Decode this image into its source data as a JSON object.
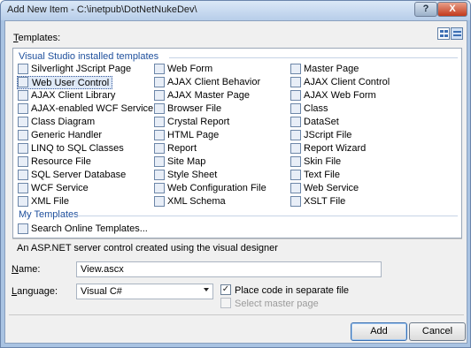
{
  "window": {
    "title": "Add New Item - C:\\inetpub\\DotNetNukeDev\\",
    "help_label": "?",
    "close_label": "X"
  },
  "templates_label": "Templates:",
  "view_buttons": [
    "large-icons-view",
    "small-icons-view"
  ],
  "groups": {
    "installed": "Visual Studio installed templates",
    "my": "My Templates"
  },
  "items": {
    "col1": [
      "Silverlight JScript Page",
      "Web User Control",
      "AJAX Client Library",
      "AJAX-enabled WCF Service",
      "Class Diagram",
      "Generic Handler",
      "LINQ to SQL Classes",
      "Resource File",
      "SQL Server Database",
      "WCF Service",
      "XML File"
    ],
    "col2": [
      "Web Form",
      "AJAX Client Behavior",
      "AJAX Master Page",
      "Browser File",
      "Crystal Report",
      "HTML Page",
      "Report",
      "Site Map",
      "Style Sheet",
      "Web Configuration File",
      "XML Schema"
    ],
    "col3": [
      "Master Page",
      "AJAX Client Control",
      "AJAX Web Form",
      "Class",
      "DataSet",
      "JScript File",
      "Report Wizard",
      "Skin File",
      "Text File",
      "Web Service",
      "XSLT File"
    ],
    "my_templates": [
      "Search Online Templates..."
    ]
  },
  "selected_item": "Web User Control",
  "description": "An ASP.NET server control created using the visual designer",
  "name": {
    "label": "Name:",
    "value": "View.ascx"
  },
  "language": {
    "label": "Language:",
    "value": "Visual C#"
  },
  "options": {
    "separate_file": {
      "label": "Place code in separate file",
      "checked": true
    },
    "master_page": {
      "label": "Select master page",
      "checked": false,
      "enabled": false
    }
  },
  "buttons": {
    "add": "Add",
    "cancel": "Cancel"
  }
}
